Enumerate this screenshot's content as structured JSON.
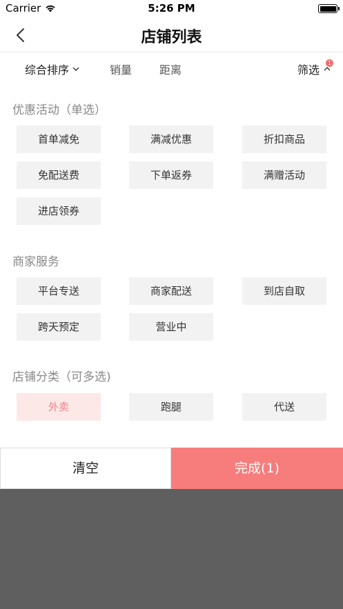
{
  "status_bar": {
    "carrier": "Carrier",
    "time": "5:26 PM"
  },
  "nav": {
    "title": "店铺列表"
  },
  "sort_bar": {
    "composite": "综合排序",
    "sales": "销量",
    "distance": "距离",
    "filter": "筛选",
    "filter_badge": "1"
  },
  "sections": {
    "promotions": {
      "title": "优惠活动（单选）",
      "options": [
        "首单减免",
        "满减优惠",
        "折扣商品",
        "免配送费",
        "下单返券",
        "满赠活动",
        "进店领券"
      ]
    },
    "services": {
      "title": "商家服务",
      "options": [
        "平台专送",
        "商家配送",
        "到店自取",
        "跨天预定",
        "营业中"
      ]
    },
    "categories": {
      "title": "店铺分类（可多选)",
      "options": [
        "外卖",
        "跑腿",
        "代送"
      ],
      "selected": "外卖"
    }
  },
  "actions": {
    "clear": "清空",
    "done": "完成(1)"
  },
  "colors": {
    "accent": "#f77d7d",
    "selected_bg": "#fde8e8",
    "selected_text": "#f08080",
    "overlay": "#5f5f5f"
  }
}
